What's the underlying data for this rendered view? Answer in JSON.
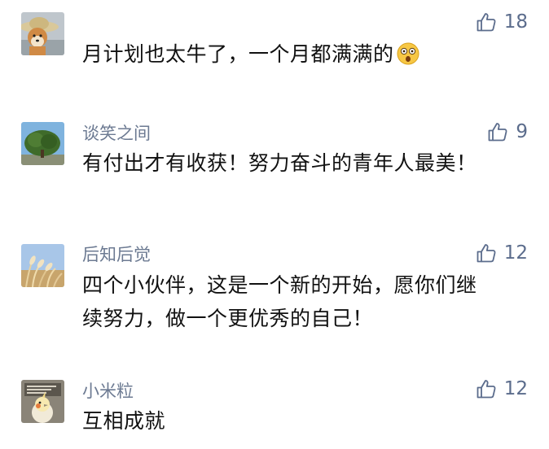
{
  "comments": [
    {
      "nickname": "",
      "lines": [
        "月计划也太牛了，一个月都满满的"
      ],
      "emoji": "astonished-face-emoji",
      "likes": "18",
      "avatar_icon": "shiba-dog-avatar"
    },
    {
      "nickname": "谈笑之间",
      "lines": [
        "有付出才有收获！努力奋斗的青年人最美！"
      ],
      "likes": "9",
      "avatar_icon": "tree-avatar"
    },
    {
      "nickname": "后知后觉",
      "lines": [
        "四个小伙伴，这是一个新的开始，愿你们继",
        "续努力，做一个更优秀的自己！"
      ],
      "likes": "12",
      "avatar_icon": "reeds-sky-avatar"
    },
    {
      "nickname": "小米粒",
      "lines": [
        "互相成就"
      ],
      "likes": "12",
      "avatar_icon": "cockatiel-avatar"
    }
  ],
  "colors": {
    "nickname": "#6c7a92",
    "like": "#5b6c8c",
    "text": "#111111"
  },
  "icons": {
    "like": "thumbs-up-icon"
  }
}
